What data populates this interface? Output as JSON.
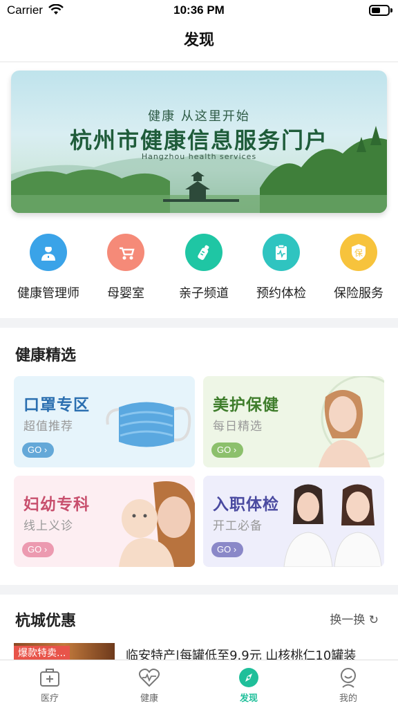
{
  "status_bar": {
    "carrier": "Carrier",
    "time": "10:36 PM"
  },
  "nav": {
    "title": "发现"
  },
  "banner": {
    "subtitle": "健康   从这里开始",
    "title": "杭州市健康信息服务门户",
    "english": "Hangzhou health services"
  },
  "shortcuts": [
    {
      "label": "健康管理师",
      "icon": "doctor-icon",
      "color": "#3aa3e8"
    },
    {
      "label": "母婴室",
      "icon": "stroller-icon",
      "color": "#f58a78"
    },
    {
      "label": "亲子频道",
      "icon": "baby-bottle-icon",
      "color": "#1fc6a4"
    },
    {
      "label": "预约体检",
      "icon": "clipboard-icon",
      "color": "#2fc4c0"
    },
    {
      "label": "保险服务",
      "icon": "shield-icon",
      "color": "#f7c33c",
      "glyph": "保"
    }
  ],
  "health_select": {
    "title": "健康精选",
    "cards": [
      {
        "title": "口罩专区",
        "subtitle": "超值推荐",
        "go": "GO",
        "title_color": "#2b6fb0",
        "bg": "#e6f4fb",
        "go_color": "#64a8d8"
      },
      {
        "title": "美护保健",
        "subtitle": "每日精选",
        "go": "GO",
        "title_color": "#3f7d2c",
        "bg": "#eef6e6",
        "go_color": "#8cc06c"
      },
      {
        "title": "妇幼专科",
        "subtitle": "线上义诊",
        "go": "GO",
        "title_color": "#c8506e",
        "bg": "#fdeef2",
        "go_color": "#ec9ab0"
      },
      {
        "title": "入职体检",
        "subtitle": "开工必备",
        "go": "GO",
        "title_color": "#4a4aa0",
        "bg": "#eeeefb",
        "go_color": "#8a88c8"
      }
    ]
  },
  "offers": {
    "title": "杭城优惠",
    "refresh_label": "换一换",
    "items": [
      {
        "tag": "爆款特卖...",
        "title": "临安特产|每罐低至9.9元 山核桃仁10罐装"
      }
    ]
  },
  "tabbar": {
    "tabs": [
      {
        "label": "医疗",
        "icon": "medical-kit-icon"
      },
      {
        "label": "健康",
        "icon": "heartbeat-icon"
      },
      {
        "label": "发现",
        "icon": "compass-icon",
        "active": true
      },
      {
        "label": "我的",
        "icon": "profile-icon"
      }
    ]
  }
}
